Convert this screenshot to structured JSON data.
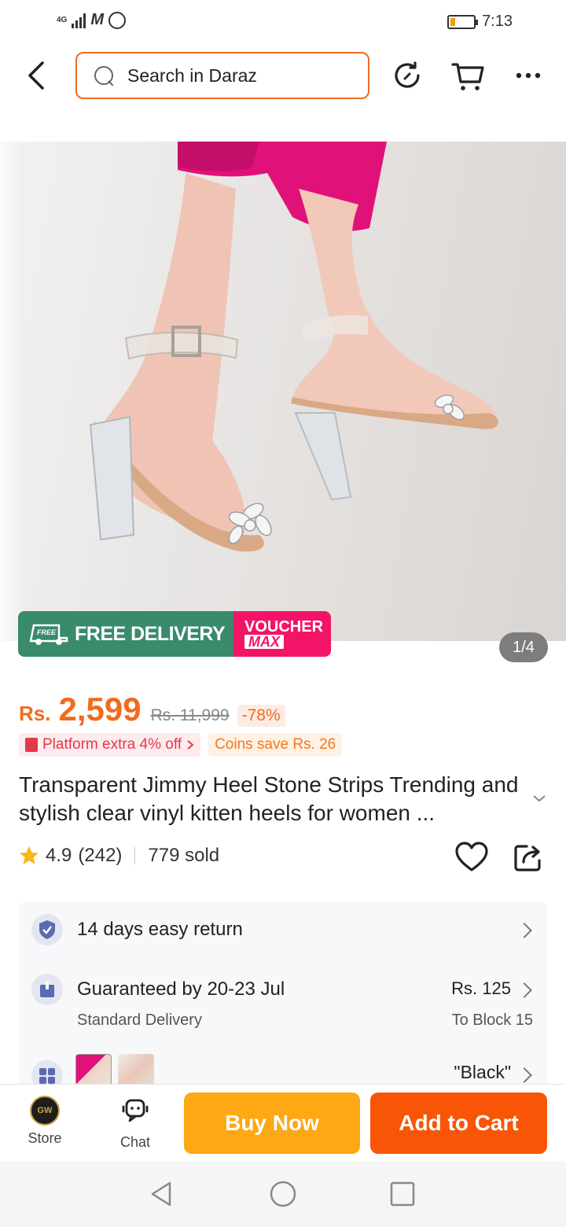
{
  "status_bar": {
    "network": "4G",
    "time": "7:13",
    "battery_level": 0.2
  },
  "header": {
    "search_placeholder": "Search in Daraz"
  },
  "gallery": {
    "free_delivery_label": "FREE DELIVERY",
    "free_tag": "FREE",
    "voucher_line1": "VOUCHER",
    "voucher_line2": "MAX",
    "pager": "1/4"
  },
  "price": {
    "currency": "Rs.",
    "amount": "2,599",
    "original": "Rs. 11,999",
    "discount": "-78%"
  },
  "promos": {
    "platform": "Platform extra 4% off",
    "coins": "Coins save Rs. 26"
  },
  "product": {
    "title": "Transparent Jimmy Heel Stone Strips Trending and stylish clear vinyl kitten heels for women ..."
  },
  "rating": {
    "score": "4.9",
    "count": "(242)",
    "sold": "779 sold"
  },
  "service": {
    "return_label": "14 days easy return",
    "delivery_label": "Guaranteed by 20-23 Jul",
    "delivery_type": "Standard Delivery",
    "delivery_fee": "Rs. 125",
    "delivery_location": "To Block 15",
    "variant_value": "\"Black\""
  },
  "bottom_bar": {
    "store_label": "Store",
    "store_logo_text": "GW",
    "chat_label": "Chat",
    "buy_now_label": "Buy Now",
    "add_to_cart_label": "Add to Cart"
  },
  "colors": {
    "brand_orange": "#f85606",
    "buy_now_yellow": "#fda814",
    "free_delivery_green": "#3a8a6c",
    "voucher_pink": "#f31468"
  }
}
